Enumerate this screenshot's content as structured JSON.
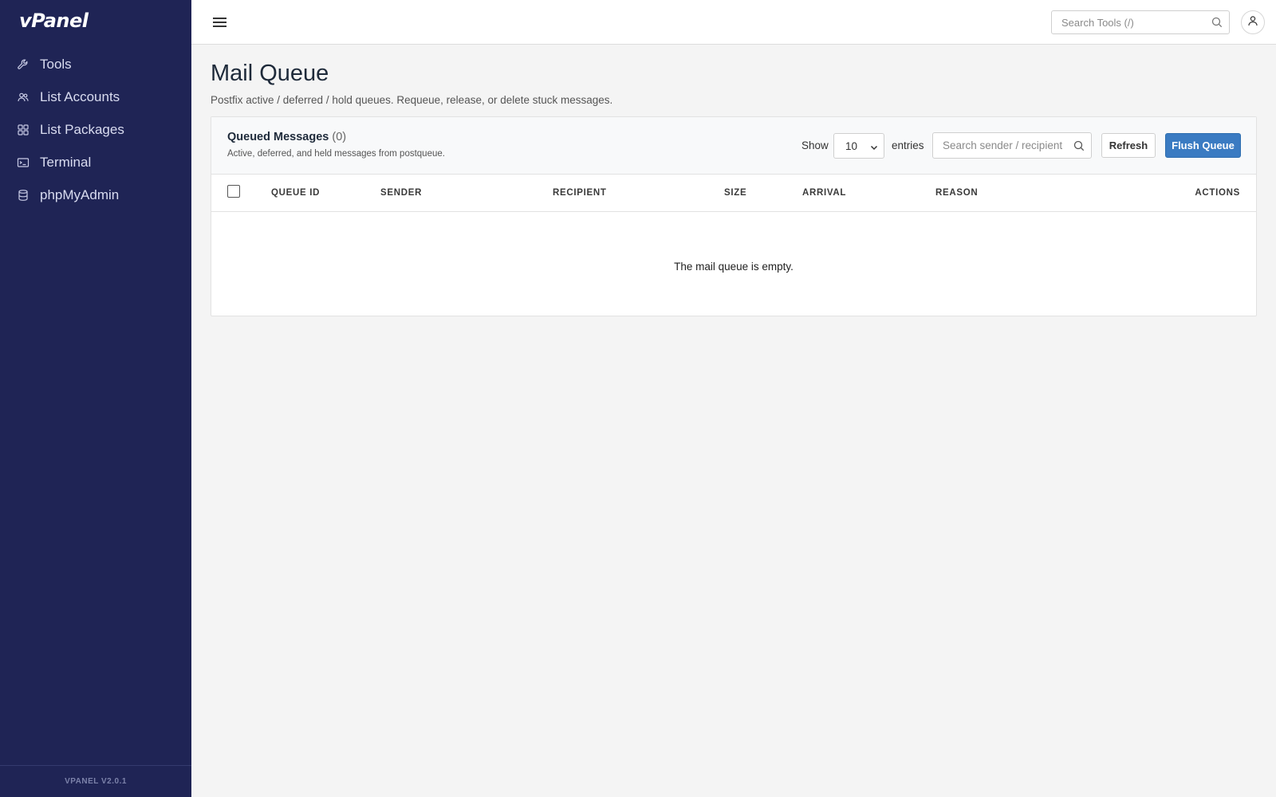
{
  "sidebar": {
    "logo": "vPanel",
    "items": [
      {
        "label": "Tools",
        "icon": "wrench-icon"
      },
      {
        "label": "List Accounts",
        "icon": "users-icon"
      },
      {
        "label": "List Packages",
        "icon": "grid-icon"
      },
      {
        "label": "Terminal",
        "icon": "terminal-icon"
      },
      {
        "label": "phpMyAdmin",
        "icon": "database-icon"
      }
    ],
    "version": "VPANEL V2.0.1"
  },
  "topbar": {
    "search_placeholder": "Search Tools (/)"
  },
  "page": {
    "title": "Mail Queue",
    "subtitle": "Postfix active / deferred / hold queues. Requeue, release, or delete stuck messages."
  },
  "card": {
    "title": "Queued Messages",
    "count": "(0)",
    "description": "Active, deferred, and held messages from postqueue.",
    "show_label": "Show",
    "entries_value": "10",
    "entries_label": "entries",
    "search_placeholder": "Search sender / recipient",
    "refresh_label": "Refresh",
    "flush_label": "Flush Queue"
  },
  "table": {
    "columns": [
      "QUEUE ID",
      "SENDER",
      "RECIPIENT",
      "SIZE",
      "ARRIVAL",
      "REASON",
      "ACTIONS"
    ],
    "empty_message": "The mail queue is empty."
  },
  "colors": {
    "sidebar_bg": "#1f2455",
    "primary_button": "#3a7bc2"
  }
}
